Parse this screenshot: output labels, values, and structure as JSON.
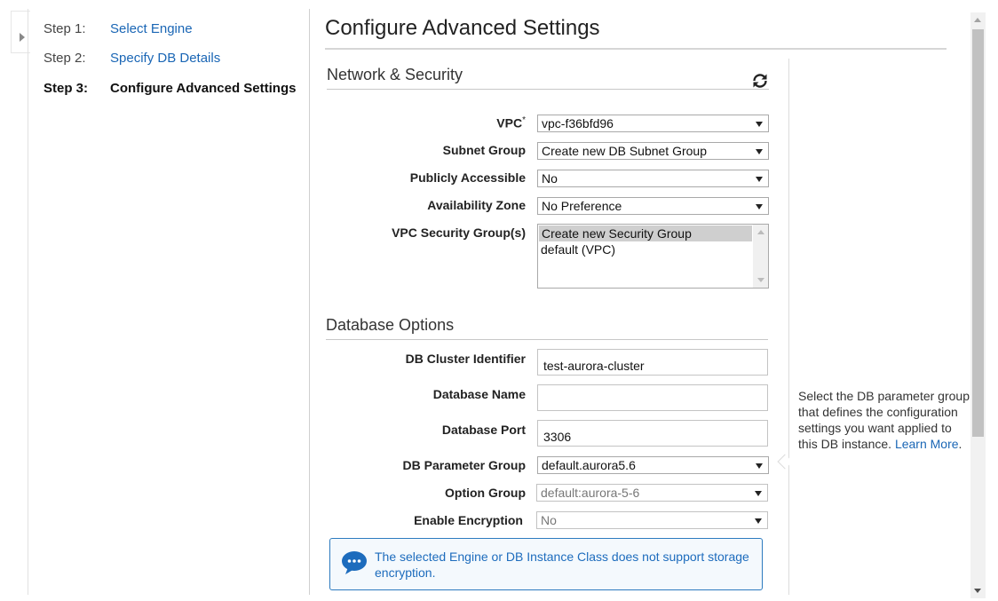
{
  "wizard": {
    "steps": [
      {
        "number": "Step 1:",
        "label": "Select Engine"
      },
      {
        "number": "Step 2:",
        "label": "Specify DB Details"
      },
      {
        "number": "Step 3:",
        "label": "Configure Advanced Settings"
      }
    ],
    "current_step": 3
  },
  "page": {
    "title": "Configure Advanced Settings"
  },
  "network_security": {
    "title": "Network & Security",
    "vpc": {
      "label": "VPC",
      "required_mark": "*",
      "value": "vpc-f36bfd96"
    },
    "subnet_group": {
      "label": "Subnet Group",
      "value": "Create new DB Subnet Group"
    },
    "publicly_accessible": {
      "label": "Publicly Accessible",
      "value": "No"
    },
    "availability_zone": {
      "label": "Availability Zone",
      "value": "No Preference"
    },
    "vpc_security_groups": {
      "label": "VPC Security Group(s)",
      "options": [
        "Create new Security Group",
        "default (VPC)"
      ],
      "selected": "Create new Security Group"
    }
  },
  "database_options": {
    "title": "Database Options",
    "db_cluster_identifier": {
      "label": "DB Cluster Identifier",
      "value": "test-aurora-cluster"
    },
    "database_name": {
      "label": "Database Name",
      "value": ""
    },
    "database_port": {
      "label": "Database Port",
      "value": "3306"
    },
    "db_parameter_group": {
      "label": "DB Parameter Group",
      "value": "default.aurora5.6"
    },
    "option_group": {
      "label": "Option Group",
      "value": "default:aurora-5-6",
      "disabled": true
    },
    "enable_encryption": {
      "label": "Enable Encryption",
      "value": "No",
      "disabled": true
    }
  },
  "help_panel": {
    "text": "Select the DB parameter group that defines the configuration settings you want applied to this DB instance.",
    "line1": "Select the DB parameter group",
    "line2": "that defines the configuration",
    "line3": "settings you want applied to",
    "line4": "this DB instance.",
    "link": "Learn More",
    "link_suffix": "."
  },
  "info_message": {
    "icon": "chat-bubble-info-icon",
    "text": "The selected Engine or DB Instance Class does not support storage encryption."
  },
  "icons": {
    "refresh": "refresh-icon",
    "toggle": "chevron-right-icon"
  },
  "colors": {
    "link": "#1a66b5",
    "info_border": "#2d7bbf"
  }
}
